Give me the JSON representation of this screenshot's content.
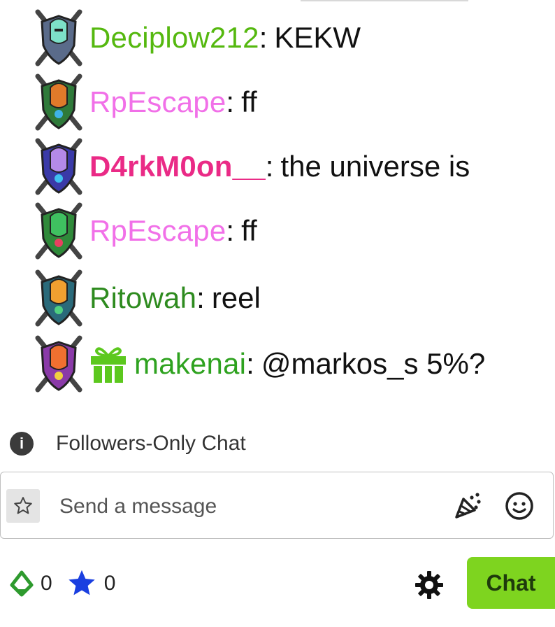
{
  "messages": [
    {
      "username": "Deciplow212",
      "color": "#55b80f",
      "text": "KEKW",
      "badge": "knight-shield-badge",
      "gift": false
    },
    {
      "username": "RpEscape",
      "color": "#f170e8",
      "text": "ff",
      "badge": "knight-shield-badge",
      "gift": false
    },
    {
      "username": "D4rkM0on__",
      "color": "#ea2a86",
      "text": "the universe is",
      "badge": "knight-shield-badge",
      "gift": false
    },
    {
      "username": "RpEscape",
      "color": "#f170e8",
      "text": "ff",
      "badge": "knight-shield-badge",
      "gift": false
    },
    {
      "username": "Ritowah",
      "color": "#2e8b1f",
      "text": "reel",
      "badge": "knight-shield-badge",
      "gift": false
    },
    {
      "username": "makenai",
      "color": "#2ea21f",
      "text": "@markos_s 5%?",
      "badge": "knight-shield-badge",
      "gift": true
    }
  ],
  "notice": {
    "text": "Followers-Only Chat",
    "icon": "info-icon"
  },
  "composer": {
    "placeholder": "Send a message",
    "star_icon": "star-outline-icon",
    "party_icon": "party-popper-icon",
    "emoji_icon": "smiley-icon"
  },
  "footer": {
    "points": [
      {
        "icon": "green-gem-icon",
        "value": "0",
        "color": "#2e9a2e"
      },
      {
        "icon": "blue-star-icon",
        "value": "0",
        "color": "#1a3fe0"
      }
    ],
    "settings_icon": "gear-icon",
    "chat_label": "Chat",
    "chat_color": "#7ed41f"
  }
}
